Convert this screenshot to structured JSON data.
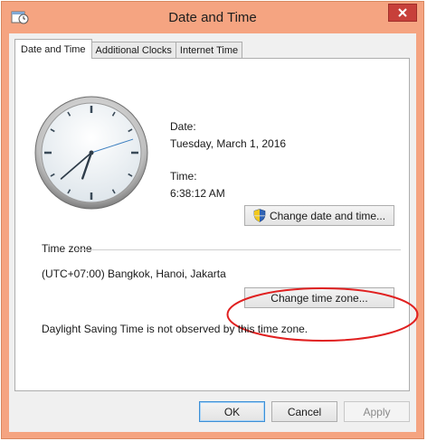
{
  "window": {
    "title": "Date and Time"
  },
  "tabs": [
    {
      "label": "Date and Time"
    },
    {
      "label": "Additional Clocks"
    },
    {
      "label": "Internet Time"
    }
  ],
  "date": {
    "label": "Date:",
    "value": "Tuesday, March 1, 2016"
  },
  "time": {
    "label": "Time:",
    "value": "6:38:12 AM"
  },
  "clock": {
    "hour": 6,
    "minute": 38,
    "second": 12
  },
  "buttons": {
    "change_date_time": "Change date and time...",
    "change_time_zone": "Change time zone...",
    "ok": "OK",
    "cancel": "Cancel",
    "apply": "Apply"
  },
  "timezone": {
    "heading": "Time zone",
    "value": "(UTC+07:00) Bangkok, Hanoi, Jakarta",
    "dst_note": "Daylight Saving Time is not observed by this time zone."
  },
  "colors": {
    "annotation": "#e02020",
    "titlebar": "#f5a481",
    "close": "#c7403a"
  }
}
